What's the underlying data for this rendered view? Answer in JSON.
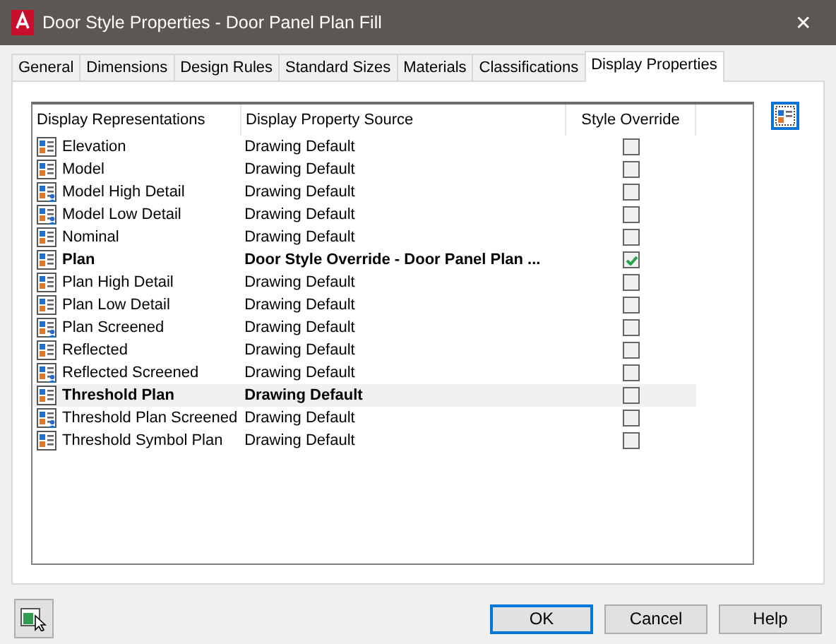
{
  "window": {
    "title": "Door Style Properties - Door Panel Plan Fill",
    "close": "✕"
  },
  "tabs": [
    {
      "label": "General",
      "selected": false
    },
    {
      "label": "Dimensions",
      "selected": false
    },
    {
      "label": "Design Rules",
      "selected": false
    },
    {
      "label": "Standard Sizes",
      "selected": false
    },
    {
      "label": "Materials",
      "selected": false
    },
    {
      "label": "Classifications",
      "selected": false
    },
    {
      "label": "Display Properties",
      "selected": true
    }
  ],
  "table": {
    "columns": [
      "Display Representations",
      "Display Property Source",
      "Style Override"
    ],
    "rows": [
      {
        "name": "Elevation",
        "source": "Drawing Default",
        "kind": "plain",
        "current": false,
        "selected": false,
        "checked": false
      },
      {
        "name": "Model",
        "source": "Drawing Default",
        "kind": "plain",
        "current": false,
        "selected": false,
        "checked": false
      },
      {
        "name": "Model High Detail",
        "source": "Drawing Default",
        "kind": "shared",
        "current": false,
        "selected": false,
        "checked": false
      },
      {
        "name": "Model Low Detail",
        "source": "Drawing Default",
        "kind": "shared",
        "current": false,
        "selected": false,
        "checked": false
      },
      {
        "name": "Nominal",
        "source": "Drawing Default",
        "kind": "plain",
        "current": false,
        "selected": false,
        "checked": false
      },
      {
        "name": "Plan",
        "source": "Door Style Override - Door Panel Plan ...",
        "kind": "plain",
        "current": true,
        "selected": false,
        "checked": true
      },
      {
        "name": "Plan High Detail",
        "source": "Drawing Default",
        "kind": "plain",
        "current": false,
        "selected": false,
        "checked": false
      },
      {
        "name": "Plan Low Detail",
        "source": "Drawing Default",
        "kind": "plain",
        "current": false,
        "selected": false,
        "checked": false
      },
      {
        "name": "Plan Screened",
        "source": "Drawing Default",
        "kind": "shared",
        "current": false,
        "selected": false,
        "checked": false
      },
      {
        "name": "Reflected",
        "source": "Drawing Default",
        "kind": "plain",
        "current": false,
        "selected": false,
        "checked": false
      },
      {
        "name": "Reflected Screened",
        "source": "Drawing Default",
        "kind": "shared",
        "current": false,
        "selected": false,
        "checked": false
      },
      {
        "name": "Threshold Plan",
        "source": "Drawing Default",
        "kind": "plain",
        "current": true,
        "selected": true,
        "checked": false
      },
      {
        "name": "Threshold Plan Screened",
        "source": "Drawing Default",
        "kind": "shared",
        "current": false,
        "selected": false,
        "checked": false
      },
      {
        "name": "Threshold Symbol Plan",
        "source": "Drawing Default",
        "kind": "plain",
        "current": false,
        "selected": false,
        "checked": false
      }
    ]
  },
  "buttons": [
    {
      "label": "OK",
      "default": true
    },
    {
      "label": "Cancel",
      "default": false
    },
    {
      "label": "Help",
      "default": false
    }
  ]
}
